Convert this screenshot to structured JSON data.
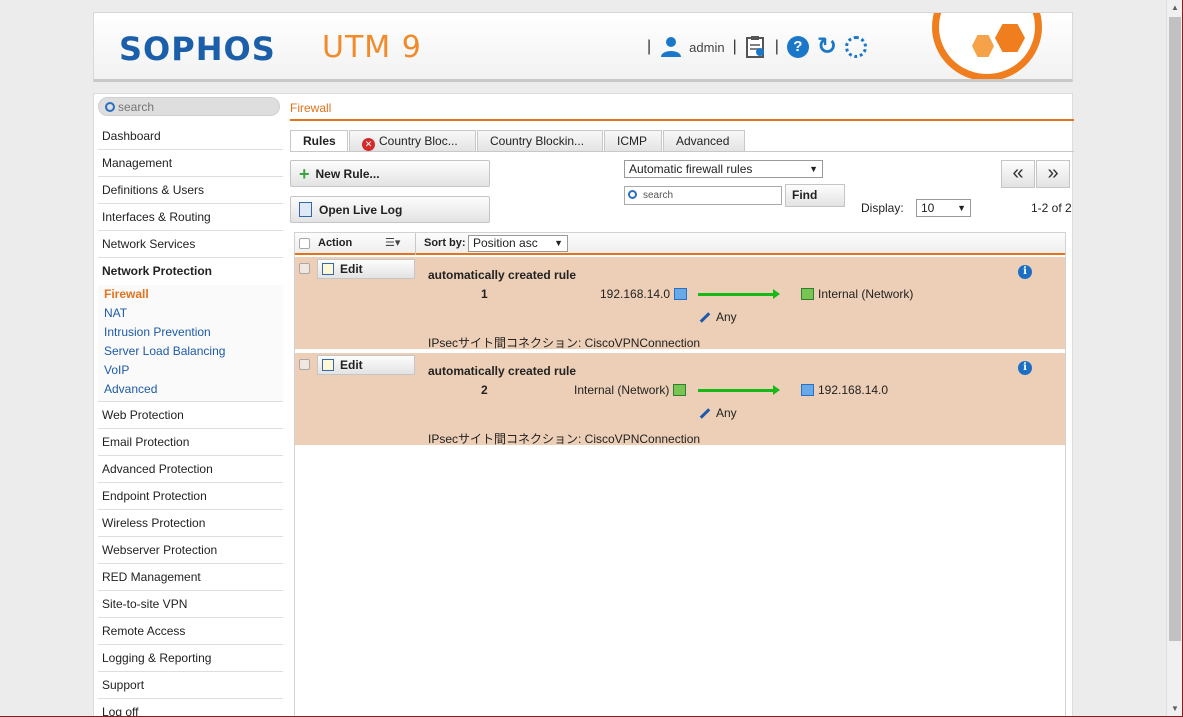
{
  "header": {
    "brand": "SOPHOS",
    "product": "UTM 9",
    "user": "admin",
    "separator": "|"
  },
  "sidebar": {
    "search_placeholder": "search",
    "items": [
      {
        "label": "Dashboard"
      },
      {
        "label": "Management"
      },
      {
        "label": "Definitions & Users"
      },
      {
        "label": "Interfaces & Routing"
      },
      {
        "label": "Network Services"
      },
      {
        "label": "Network Protection"
      },
      {
        "label": "Web Protection"
      },
      {
        "label": "Email Protection"
      },
      {
        "label": "Advanced Protection"
      },
      {
        "label": "Endpoint Protection"
      },
      {
        "label": "Wireless Protection"
      },
      {
        "label": "Webserver Protection"
      },
      {
        "label": "RED Management"
      },
      {
        "label": "Site-to-site VPN"
      },
      {
        "label": "Remote Access"
      },
      {
        "label": "Logging & Reporting"
      },
      {
        "label": "Support"
      },
      {
        "label": "Log off"
      }
    ],
    "subitems": [
      {
        "label": "Firewall"
      },
      {
        "label": "NAT"
      },
      {
        "label": "Intrusion Prevention"
      },
      {
        "label": "Server Load Balancing"
      },
      {
        "label": "VoIP"
      },
      {
        "label": "Advanced"
      }
    ]
  },
  "content": {
    "breadcrumb": "Firewall",
    "tabs": [
      {
        "label": "Rules"
      },
      {
        "label": "Country Bloc..."
      },
      {
        "label": "Country Blockin..."
      },
      {
        "label": "ICMP"
      },
      {
        "label": "Advanced"
      }
    ],
    "new_rule_label": "New Rule...",
    "open_log_label": "Open Live Log",
    "filter_select": "Automatic firewall rules",
    "search_placeholder": "search",
    "find_label": "Find",
    "display_label": "Display:",
    "display_value": "10",
    "page_info": "1-2 of 2",
    "prev_label": "«",
    "next_label": "»",
    "table": {
      "action_header": "Action",
      "sortby_label": "Sort by:",
      "sort_value": "Position asc",
      "edit_label": "Edit",
      "rows": [
        {
          "title": "automatically created rule",
          "position": "1",
          "source": "192.168.14.0",
          "destination": "Internal (Network)",
          "service": "Any",
          "comment": "IPsecサイト間コネクション: CiscoVPNConnection"
        },
        {
          "title": "automatically created rule",
          "position": "2",
          "source": "Internal (Network)",
          "destination": "192.168.14.0",
          "service": "Any",
          "comment": "IPsecサイト間コネクション: CiscoVPNConnection"
        }
      ]
    }
  }
}
